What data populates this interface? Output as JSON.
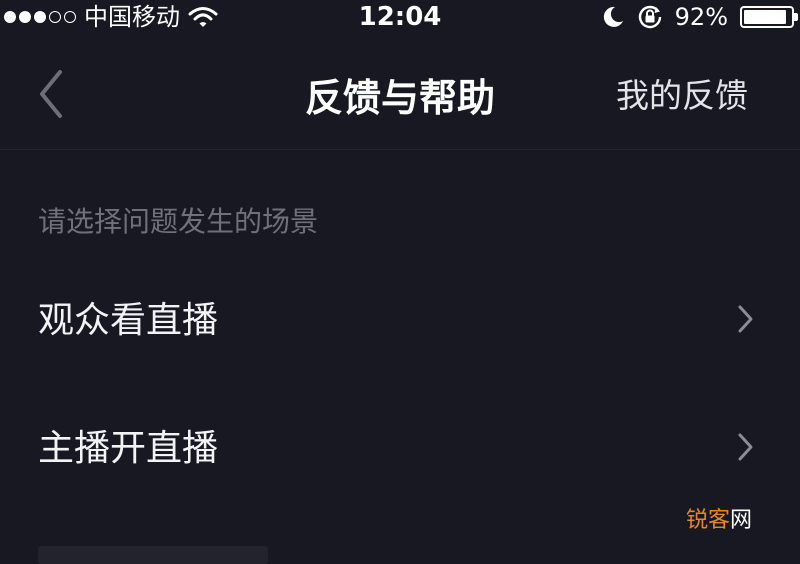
{
  "status_bar": {
    "carrier": "中国移动",
    "time": "12:04",
    "battery_percent": "92%",
    "battery_level": 0.92,
    "signal_strength": 3,
    "signal_max": 5,
    "icons": [
      "wifi-icon",
      "moon-icon",
      "rotation-lock-icon",
      "battery-icon"
    ]
  },
  "nav": {
    "back_icon": "chevron-left-icon",
    "title": "反馈与帮助",
    "right_action": "我的反馈"
  },
  "section": {
    "header": "请选择问题发生的场景"
  },
  "items": [
    {
      "label": "观众看直播",
      "icon": "chevron-right-icon"
    },
    {
      "label": "主播开直播",
      "icon": "chevron-right-icon"
    }
  ],
  "watermark": {
    "part1": "锐客",
    "part2": "网"
  },
  "colors": {
    "background": "#171821",
    "text_primary": "#f3f3f5",
    "text_secondary": "#6e707c",
    "chevron": "#8a8c96",
    "watermark_accent": "#e8871e"
  }
}
